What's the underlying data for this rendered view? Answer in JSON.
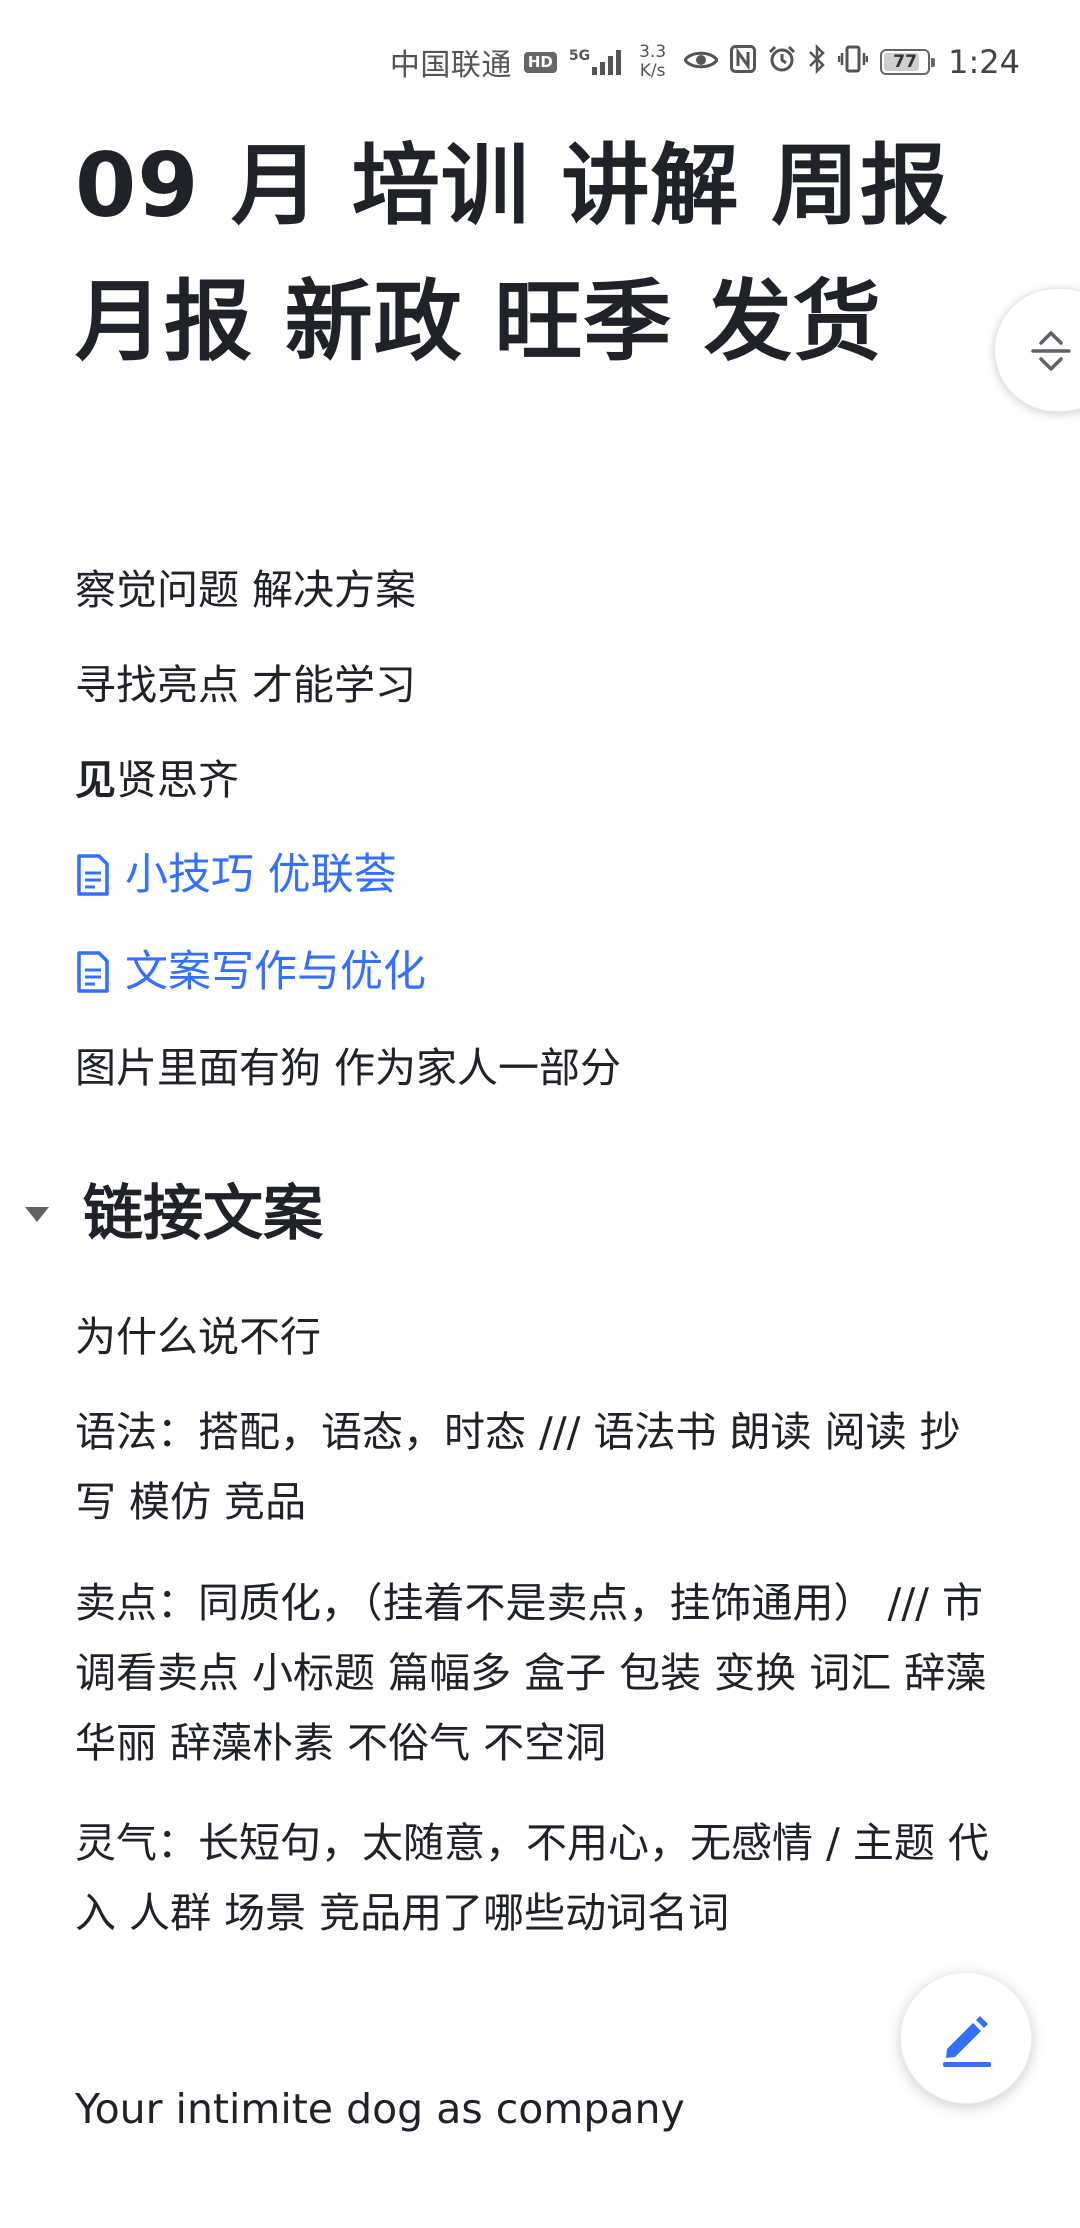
{
  "status_bar": {
    "carrier": "中国联通",
    "hd": "HD",
    "network": "5G",
    "speed_value": "3.3",
    "speed_unit": "K/s",
    "battery": "77",
    "time": "1:24"
  },
  "document": {
    "title": "09 月 培训 讲解 周报 月报 新政 旺季 发货",
    "paragraphs": {
      "p1": "察觉问题 解决方案",
      "p2": "寻找亮点  才能学习",
      "p3_bold": "见",
      "p3_rest": "贤思齐",
      "p4": "图片里面有狗  作为家人一部分"
    },
    "links": [
      {
        "label": "小技巧 优联荟"
      },
      {
        "label": "文案写作与优化"
      }
    ],
    "section": {
      "heading": "链接文案",
      "items": {
        "s1": "为什么说不行",
        "s2": "语法：搭配，语态，时态 /// 语法书 朗读 阅读 抄写 模仿 竞品",
        "s3": "卖点：同质化，（挂着不是卖点，挂饰通用） ///  市调看卖点 小标题 篇幅多 盒子 包装 变换 词汇  辞藻华丽 辞藻朴素 不俗气 不空洞",
        "s4": "灵气：长短句，太随意，不用心，无感情 / 主题 代入 人群 场景 竞品用了哪些动词名词"
      }
    },
    "footer_text": "Your  intimite  dog as company"
  },
  "icons": {
    "outline": "outline-toggle-icon",
    "edit": "edit-pencil-icon",
    "doc": "doc-icon",
    "collapse": "caret-down-icon"
  },
  "colors": {
    "link": "#3370ff",
    "text": "#1f2329"
  }
}
